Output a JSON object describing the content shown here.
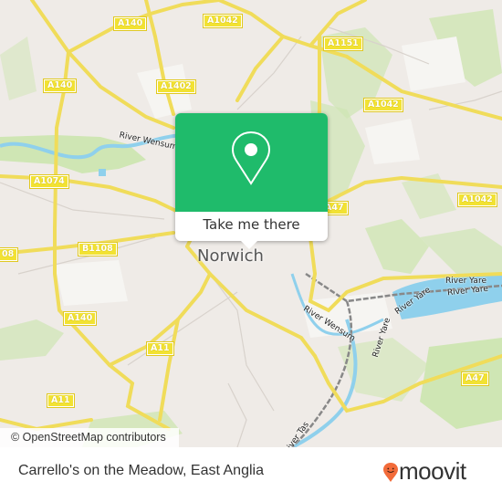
{
  "map": {
    "city_label": "Norwich",
    "road_labels": [
      {
        "id": "a140-top",
        "text": "A140"
      },
      {
        "id": "a1042-top",
        "text": "A1042"
      },
      {
        "id": "a140-left",
        "text": "A140"
      },
      {
        "id": "a1402",
        "text": "A1402"
      },
      {
        "id": "a1151",
        "text": "A1151"
      },
      {
        "id": "a1042-right",
        "text": "A1042"
      },
      {
        "id": "a1074",
        "text": "A1074"
      },
      {
        "id": "a1042-east",
        "text": "A1042"
      },
      {
        "id": "a47-top",
        "text": "A47"
      },
      {
        "id": "b1108-left",
        "text": "08"
      },
      {
        "id": "b1108",
        "text": "B1108"
      },
      {
        "id": "a140-south",
        "text": "A140"
      },
      {
        "id": "a11-mid",
        "text": "A11"
      },
      {
        "id": "a11-left",
        "text": "A11"
      },
      {
        "id": "a47-right",
        "text": "A47"
      }
    ],
    "river_labels": [
      {
        "id": "wensum-north",
        "text": "River Wensum"
      },
      {
        "id": "wensum-south",
        "text": "River Wensum"
      },
      {
        "id": "yare-1",
        "text": "River Yare"
      },
      {
        "id": "yare-2",
        "text": "River Yare"
      },
      {
        "id": "yare-3",
        "text": "River Yare"
      },
      {
        "id": "yare-4",
        "text": "River Yare"
      },
      {
        "id": "tas",
        "text": "River Tas"
      }
    ],
    "attribution": "© OpenStreetMap contributors"
  },
  "popup": {
    "icon": "map-pin-icon",
    "button_label": "Take me there",
    "color": "#1fbb6b"
  },
  "footer": {
    "title": "Carrello's on the Meadow, East Anglia",
    "brand": "moovit",
    "brand_icon": "moovit-smiley-pin-icon",
    "brand_color": "#f26b3a"
  }
}
